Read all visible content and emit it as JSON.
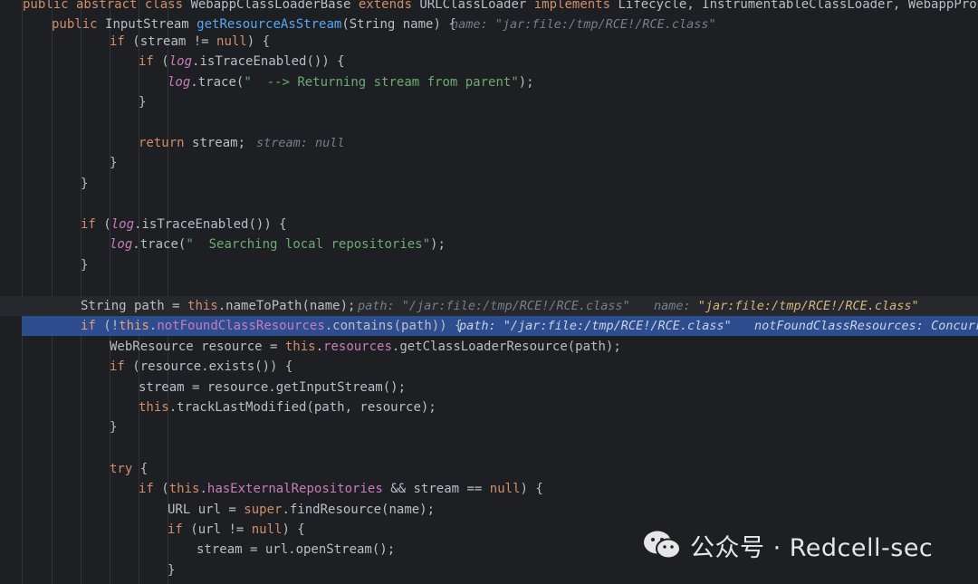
{
  "lines": [
    {
      "id": "l0",
      "code": [
        [
          "kw",
          "public abstract class "
        ],
        [
          "",
          "WebappClassLoaderBase "
        ],
        [
          "kw",
          "extends "
        ],
        [
          "",
          "URLClassLoader "
        ],
        [
          "kw",
          "implements "
        ],
        [
          "",
          "Lifecycle, InstrumentableClassLoader, WebappProperties,"
        ]
      ]
    },
    {
      "id": "l1",
      "code": [
        [
          "kw",
          "public "
        ],
        [
          "",
          "InputStream "
        ],
        [
          "fn",
          "getResourceAsStream"
        ],
        [
          "",
          "(String name) {"
        ]
      ],
      "hints": [
        {
          "label": "name: \"jar:file:/tmp/RCE!/RCE.class\""
        }
      ]
    },
    {
      "id": "l2",
      "code": [
        [
          "kw",
          "if "
        ],
        [
          "",
          "(stream != "
        ],
        [
          "kw",
          "null"
        ],
        [
          "",
          ") {"
        ]
      ]
    },
    {
      "id": "l3",
      "code": [
        [
          "kw",
          "if "
        ],
        [
          "",
          "("
        ],
        [
          "itf",
          "log"
        ],
        [
          "",
          ".isTraceEnabled()) {"
        ]
      ]
    },
    {
      "id": "l4",
      "code": [
        [
          "itf",
          "log"
        ],
        [
          "",
          ".trace("
        ],
        [
          "str",
          "\"  --> Returning stream from parent\""
        ],
        [
          "",
          ");"
        ]
      ]
    },
    {
      "id": "l5",
      "code": [
        [
          "",
          "}"
        ]
      ]
    },
    {
      "id": "l6",
      "code": []
    },
    {
      "id": "l7",
      "code": [
        [
          "kw",
          "return "
        ],
        [
          "",
          "stream;"
        ]
      ],
      "hints": [
        {
          "label": "stream: null"
        }
      ]
    },
    {
      "id": "l8",
      "code": [
        [
          "",
          "}"
        ]
      ]
    },
    {
      "id": "l9",
      "code": [
        [
          "",
          "}"
        ]
      ]
    },
    {
      "id": "l10",
      "code": []
    },
    {
      "id": "l11",
      "code": [
        [
          "kw",
          "if "
        ],
        [
          "",
          "("
        ],
        [
          "itf",
          "log"
        ],
        [
          "",
          ".isTraceEnabled()) {"
        ]
      ]
    },
    {
      "id": "l12",
      "code": [
        [
          "itf",
          "log"
        ],
        [
          "",
          ".trace("
        ],
        [
          "str",
          "\"  Searching local repositories\""
        ],
        [
          "",
          ");"
        ]
      ]
    },
    {
      "id": "l13",
      "code": [
        [
          "",
          "}"
        ]
      ]
    },
    {
      "id": "l14",
      "code": []
    },
    {
      "id": "l15",
      "code": [
        [
          "",
          "String path = "
        ],
        [
          "kw",
          "this"
        ],
        [
          "",
          ".nameToPath(name);"
        ]
      ],
      "hints": [
        {
          "label": "path: \"/jar:file:/tmp/RCE!/RCE.class\""
        },
        {
          "label": "name: ",
          "value": "\"jar:file:/tmp/RCE!/RCE.class\""
        }
      ]
    },
    {
      "id": "l16",
      "code": [
        [
          "kw",
          "if "
        ],
        [
          "",
          "(!"
        ],
        [
          "kw",
          "this"
        ],
        [
          "",
          "."
        ],
        [
          "fld",
          "notFoundClassResources"
        ],
        [
          "",
          ".contains(path)) {"
        ]
      ],
      "hints": [
        {
          "label": "path: \"/jar:file:/tmp/RCE!/RCE.class\""
        },
        {
          "label": "notFoundClassResources: Concurr"
        }
      ]
    },
    {
      "id": "l17",
      "code": [
        [
          "",
          "WebResource resource = "
        ],
        [
          "kw",
          "this"
        ],
        [
          "",
          "."
        ],
        [
          "fld",
          "resources"
        ],
        [
          "",
          ".getClassLoaderResource(path);"
        ]
      ]
    },
    {
      "id": "l18",
      "code": [
        [
          "kw",
          "if "
        ],
        [
          "",
          "(resource.exists()) {"
        ]
      ]
    },
    {
      "id": "l19",
      "code": [
        [
          "",
          "stream = resource.getInputStream();"
        ]
      ]
    },
    {
      "id": "l20",
      "code": [
        [
          "kw",
          "this"
        ],
        [
          "",
          ".trackLastModified(path, resource);"
        ]
      ]
    },
    {
      "id": "l21",
      "code": [
        [
          "",
          "}"
        ]
      ]
    },
    {
      "id": "l22",
      "code": []
    },
    {
      "id": "l23",
      "code": [
        [
          "kw",
          "try "
        ],
        [
          "",
          "{"
        ]
      ]
    },
    {
      "id": "l24",
      "code": [
        [
          "kw",
          "if "
        ],
        [
          "",
          "("
        ],
        [
          "kw",
          "this"
        ],
        [
          "",
          "."
        ],
        [
          "fld",
          "hasExternalRepositories"
        ],
        [
          "",
          " && stream == "
        ],
        [
          "kw",
          "null"
        ],
        [
          "",
          ") {"
        ]
      ]
    },
    {
      "id": "l25",
      "code": [
        [
          "",
          "URL url = "
        ],
        [
          "kw",
          "super"
        ],
        [
          "",
          ".findResource(name);"
        ]
      ]
    },
    {
      "id": "l26",
      "code": [
        [
          "kw",
          "if "
        ],
        [
          "",
          "(url != "
        ],
        [
          "kw",
          "null"
        ],
        [
          "",
          ") {"
        ]
      ]
    },
    {
      "id": "l27",
      "code": [
        [
          "",
          "stream = url.openStream();"
        ]
      ]
    },
    {
      "id": "l28",
      "code": [
        [
          "",
          "}"
        ]
      ]
    }
  ],
  "watermark": {
    "text": "公众号 · Redcell-sec",
    "icon": "wechat-icon"
  },
  "colors": {
    "background": "#1e1f22",
    "keyword": "#cf8e6d",
    "method": "#56a8f5",
    "field": "#c77dbb",
    "string": "#6aab73",
    "hint": "#7a7e85",
    "highlight": "#2d4d8f"
  }
}
